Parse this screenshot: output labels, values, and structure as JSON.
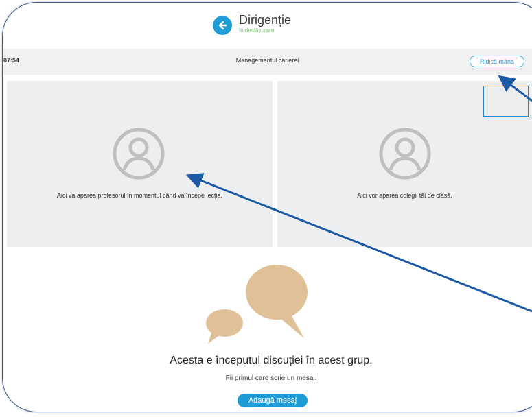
{
  "header": {
    "title": "Dirigenție",
    "status": "în desfășurare",
    "back_icon": "arrow-left-icon"
  },
  "toolbar": {
    "timer": "07:54",
    "lesson_title": "Managementul carierei",
    "raise_hand_label": "Ridică mâna"
  },
  "panels": {
    "teacher_text": "Aici va aparea profesorul în momentul când va începe lecția.",
    "classmates_text": "Aici vor aparea colegii tăi de clasă.",
    "avatar_icon": "user-avatar-icon"
  },
  "chat": {
    "empty_title": "Acesta e începutul discuției în acest grup.",
    "empty_subtitle": "Fii primul care scrie un mesaj.",
    "add_message_label": "Adaugă mesaj",
    "illustration": "speech-bubbles-icon"
  },
  "colors": {
    "accent": "#1f9bd6",
    "status_green": "#7cc576",
    "panel_bg": "#eceeef",
    "bubble": "#e0c096",
    "annotation_arrow": "#1c5aa6"
  }
}
